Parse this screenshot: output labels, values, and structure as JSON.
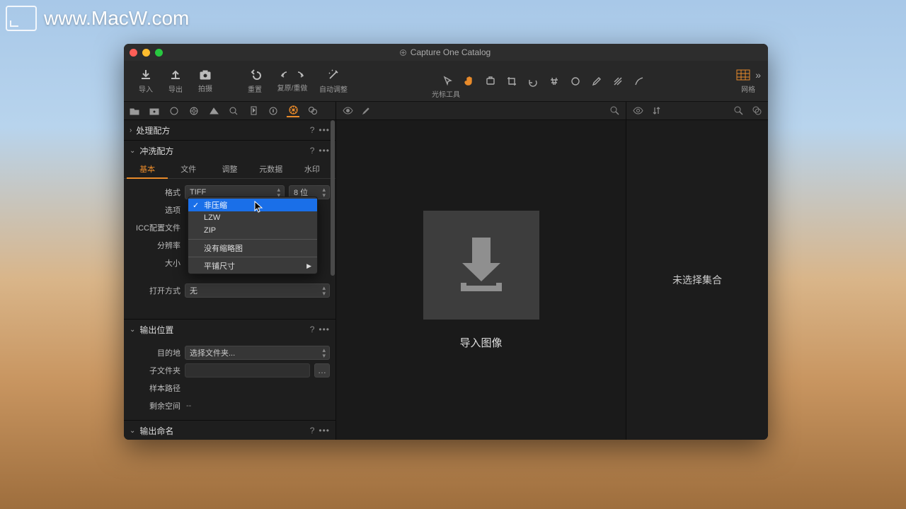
{
  "watermark": "www.MacW.com",
  "window": {
    "title": "Capture One Catalog"
  },
  "toolbar": {
    "import": "导入",
    "export": "导出",
    "capture": "拍摄",
    "reset": "重置",
    "undoRedo": "复原/重做",
    "autoAdjust": "自动调整",
    "cursorTools": "光标工具",
    "grid": "网格"
  },
  "sections": {
    "processRecipe": "处理配方",
    "developRecipe": "冲洗配方",
    "outputLocation": "输出位置",
    "outputNaming": "输出命名"
  },
  "innerTabs": {
    "basic": "基本",
    "file": "文件",
    "adjust": "调整",
    "metadata": "元数据",
    "watermark": "水印"
  },
  "form": {
    "formatLabel": "格式",
    "formatValue": "TIFF",
    "bitDepth": "8 位",
    "optionsLabel": "选项",
    "iccLabel": "ICC配置文件",
    "resolutionLabel": "分辨率",
    "sizeLabel": "大小",
    "openWithLabel": "打开方式",
    "openWithValue": "无"
  },
  "dropdown": {
    "uncompressed": "非压缩",
    "lzw": "LZW",
    "zip": "ZIP",
    "noThumbnail": "没有缩略图",
    "tileSize": "平铺尺寸"
  },
  "output": {
    "destLabel": "目的地",
    "destValue": "选择文件夹...",
    "subfolderLabel": "子文件夹",
    "samplePathLabel": "样本路径",
    "freeSpaceLabel": "剩余空间",
    "freeSpaceValue": "--"
  },
  "viewer": {
    "importImages": "导入图像"
  },
  "browser": {
    "noCollection": "未选择集合"
  },
  "misc": {
    "help": "?",
    "more": "•••"
  }
}
